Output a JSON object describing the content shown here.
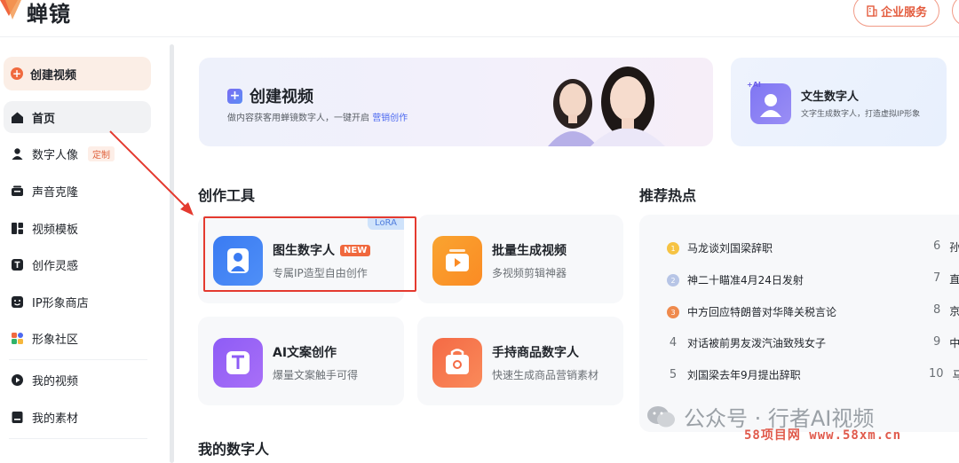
{
  "header": {
    "app_name": "蝉镜",
    "enterprise_button": "企业服务"
  },
  "sidebar": {
    "create_button": "创建视频",
    "items": [
      {
        "label": "首页",
        "icon": "home-icon",
        "active": true
      },
      {
        "label": "数字人像",
        "icon": "person-icon",
        "tag": "定制"
      },
      {
        "label": "声音克隆",
        "icon": "microphone-icon"
      },
      {
        "label": "视频模板",
        "icon": "template-icon"
      },
      {
        "label": "创作灵感",
        "icon": "text-t-icon"
      },
      {
        "label": "IP形象商店",
        "icon": "face-icon"
      },
      {
        "label": "形象社区",
        "icon": "community-icon"
      },
      {
        "label": "我的视频",
        "icon": "play-circle-icon"
      },
      {
        "label": "我的素材",
        "icon": "folder-icon"
      }
    ]
  },
  "banner": {
    "title": "创建视频",
    "subtitle": "做内容获客用蝉镜数字人，一键开启",
    "link": "营销创作"
  },
  "side_card": {
    "badge": "+AI",
    "title": "文生数字人",
    "subtitle": "文字生成数字人，打造虚拟IP形象"
  },
  "tools_section": {
    "title": "创作工具",
    "tools": [
      {
        "title": "图生数字人",
        "subtitle": "专属IP造型自由创作",
        "tag": "NEW",
        "corner": "LoRA",
        "icon": "person-portrait-icon"
      },
      {
        "title": "批量生成视频",
        "subtitle": "多视频剪辑神器",
        "icon": "video-stack-icon"
      },
      {
        "title": "AI文案创作",
        "subtitle": "爆量文案触手可得",
        "icon": "text-t-icon"
      },
      {
        "title": "手持商品数字人",
        "subtitle": "快速生成商品营销素材",
        "icon": "shopping-bag-icon"
      }
    ]
  },
  "hot_section": {
    "title": "推荐热点",
    "items": [
      {
        "rank": "1",
        "text": "马龙谈刘国梁辞职"
      },
      {
        "rank": "2",
        "text": "神二十瞄准4月24日发射"
      },
      {
        "rank": "3",
        "text": "中方回应特朗普对华降关税言论"
      },
      {
        "rank": "4",
        "text": "对话被前男友泼汽油致残女子"
      },
      {
        "rank": "5",
        "text": "刘国梁去年9月提出辞职"
      }
    ],
    "right_items": [
      {
        "rank": "6",
        "text": "孙"
      },
      {
        "rank": "7",
        "text": "直"
      },
      {
        "rank": "8",
        "text": "京"
      },
      {
        "rank": "9",
        "text": "中"
      },
      {
        "rank": "10",
        "text": "马"
      }
    ]
  },
  "my_avatars_section": {
    "title": "我的数字人"
  },
  "watermark": {
    "text": "公众号 · 行者AI视频",
    "url": "58项目网 www.58xm.cn"
  },
  "colors": {
    "accent": "#f06a3f",
    "highlight": "#e43a2f",
    "link": "#4d69f0"
  }
}
